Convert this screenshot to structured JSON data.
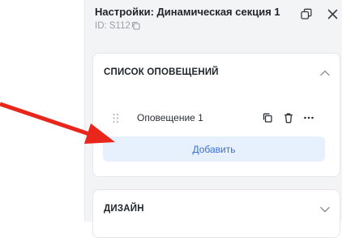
{
  "settings_panel": {
    "title": "Настройки: Динамическая секция 1",
    "id_label": "ID: S112"
  },
  "notifications_section": {
    "title": "СПИСОК ОПОВЕЩЕНИЙ",
    "items": [
      {
        "label": "Оповещение 1"
      }
    ],
    "add_button_label": "Добавить"
  },
  "design_section": {
    "title": "ДИЗАЙН"
  },
  "annotation": {
    "arrow_color": "#e8261c"
  },
  "colors": {
    "accent": "#3a6fd8",
    "accent_bg": "#e7f0fd",
    "panel_bg": "#f3f4f6"
  },
  "icons": [
    "copy-icon",
    "popout-icon",
    "close-icon",
    "chevron-up-icon",
    "chevron-down-icon",
    "drag-handle-icon",
    "duplicate-icon",
    "trash-icon",
    "more-icon"
  ]
}
